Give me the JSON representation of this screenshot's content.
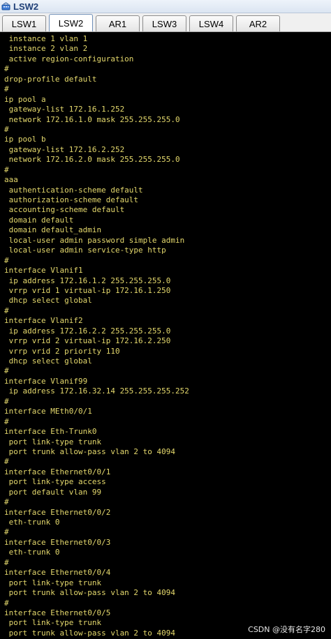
{
  "window": {
    "title": "LSW2"
  },
  "tabs": [
    {
      "label": "LSW1"
    },
    {
      "label": "LSW2",
      "active": true
    },
    {
      "label": "AR1"
    },
    {
      "label": "LSW3"
    },
    {
      "label": "LSW4"
    },
    {
      "label": "AR2"
    }
  ],
  "terminal": {
    "text_color": "#e4d86c",
    "background": "#000000",
    "lines": [
      " instance 1 vlan 1",
      " instance 2 vlan 2",
      " active region-configuration",
      "#",
      "drop-profile default",
      "#",
      "ip pool a",
      " gateway-list 172.16.1.252",
      " network 172.16.1.0 mask 255.255.255.0",
      "#",
      "ip pool b",
      " gateway-list 172.16.2.252",
      " network 172.16.2.0 mask 255.255.255.0",
      "#",
      "aaa",
      " authentication-scheme default",
      " authorization-scheme default",
      " accounting-scheme default",
      " domain default",
      " domain default_admin",
      " local-user admin password simple admin",
      " local-user admin service-type http",
      "#",
      "interface Vlanif1",
      " ip address 172.16.1.2 255.255.255.0",
      " vrrp vrid 1 virtual-ip 172.16.1.250",
      " dhcp select global",
      "#",
      "interface Vlanif2",
      " ip address 172.16.2.2 255.255.255.0",
      " vrrp vrid 2 virtual-ip 172.16.2.250",
      " vrrp vrid 2 priority 110",
      " dhcp select global",
      "#",
      "interface Vlanif99",
      " ip address 172.16.32.14 255.255.255.252",
      "#",
      "interface MEth0/0/1",
      "#",
      "interface Eth-Trunk0",
      " port link-type trunk",
      " port trunk allow-pass vlan 2 to 4094",
      "#",
      "interface Ethernet0/0/1",
      " port link-type access",
      " port default vlan 99",
      "#",
      "interface Ethernet0/0/2",
      " eth-trunk 0",
      "#",
      "interface Ethernet0/0/3",
      " eth-trunk 0",
      "#",
      "interface Ethernet0/0/4",
      " port link-type trunk",
      " port trunk allow-pass vlan 2 to 4094",
      "#",
      "interface Ethernet0/0/5",
      " port link-type trunk",
      " port trunk allow-pass vlan 2 to 4094"
    ]
  },
  "watermark": "CSDN @没有名字280",
  "icons": {
    "app": "switch-icon"
  }
}
